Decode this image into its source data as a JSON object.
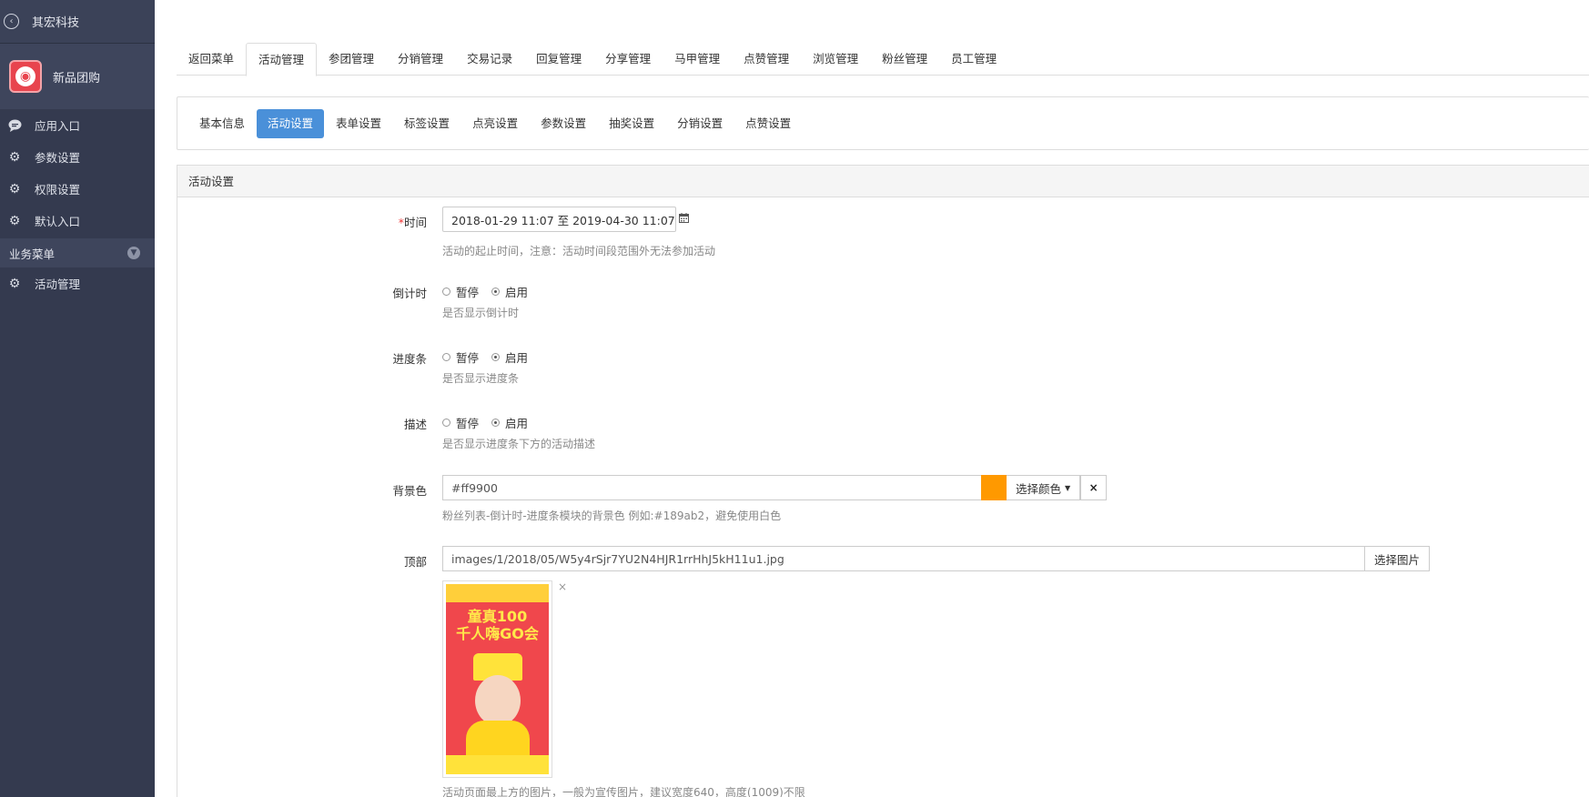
{
  "sidebar": {
    "back_label": "其宏科技",
    "app_name": "新品团购",
    "items": [
      {
        "label": "应用入口",
        "icon": "chat-icon"
      },
      {
        "label": "参数设置",
        "icon": "gear-icon"
      },
      {
        "label": "权限设置",
        "icon": "gear-icon"
      },
      {
        "label": "默认入口",
        "icon": "gear-icon"
      }
    ],
    "section_label": "业务菜单",
    "section_items": [
      {
        "label": "活动管理",
        "icon": "gear-icon"
      }
    ]
  },
  "top_tabs": [
    "返回菜单",
    "活动管理",
    "参团管理",
    "分销管理",
    "交易记录",
    "回复管理",
    "分享管理",
    "马甲管理",
    "点赞管理",
    "浏览管理",
    "粉丝管理",
    "员工管理"
  ],
  "sub_tabs": [
    "基本信息",
    "活动设置",
    "表单设置",
    "标签设置",
    "点亮设置",
    "参数设置",
    "抽奖设置",
    "分销设置",
    "点赞设置"
  ],
  "panel_title": "活动设置",
  "form": {
    "time": {
      "required_mark": "*",
      "label": "时间",
      "value": "2018-01-29 11:07 至 2019-04-30 11:07",
      "help": "活动的起止时间，注意：活动时间段范围外无法参加活动"
    },
    "countdown": {
      "label": "倒计时",
      "opt_off": "暂停",
      "opt_on": "启用",
      "help": "是否显示倒计时"
    },
    "progress": {
      "label": "进度条",
      "opt_off": "暂停",
      "opt_on": "启用",
      "help": "是否显示进度条"
    },
    "desc": {
      "label": "描述",
      "opt_off": "暂停",
      "opt_on": "启用",
      "help": "是否显示进度条下方的活动描述"
    },
    "bgcolor": {
      "label": "背景色",
      "value": "#ff9900",
      "swatch": "#ff9900",
      "pick_label": "选择颜色",
      "clear_label": "×",
      "help": "粉丝列表-倒计时-进度条模块的背景色 例如:#189ab2，避免使用白色"
    },
    "top_image": {
      "label": "顶部",
      "value": "images/1/2018/05/W5y4rSjr7YU2N4HJR1rrHhJ5kH11u1.jpg",
      "button_label": "选择图片",
      "close_label": "×",
      "help": "活动页面最上方的图片，一般为宣传图片，建议宽度640，高度(1009)不限"
    }
  },
  "colors": {
    "sidebar_bg": "#343a4f",
    "active_tab": "#4a90d9",
    "required": "#e33333"
  }
}
